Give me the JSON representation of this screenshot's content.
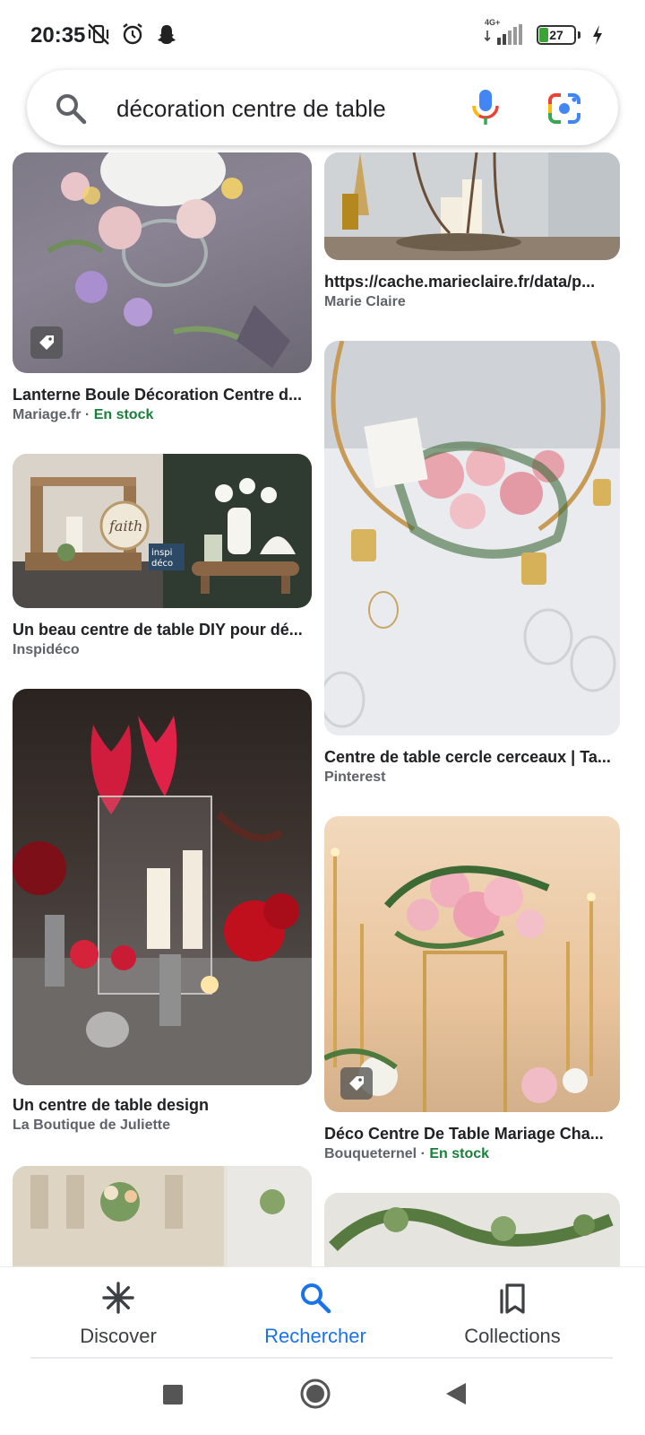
{
  "status_bar": {
    "time": "20:35",
    "network": "4G+",
    "battery": "27",
    "battery_level": 0.27,
    "icons": [
      "vibrate-off-icon",
      "alarm-icon",
      "snapchat-icon",
      "signal-icon",
      "charging-icon"
    ]
  },
  "search": {
    "query": "décoration centre de table",
    "icons": [
      "search-icon",
      "mic-icon",
      "lens-icon"
    ]
  },
  "results": [
    {
      "title": "Lanterne Boule Décoration Centre d...",
      "source": "Mariage.fr",
      "stock": "En stock",
      "tagged": true
    },
    {
      "title": "https://cache.marieclaire.fr/data/p...",
      "source": "Marie Claire",
      "stock": "",
      "tagged": false
    },
    {
      "title": "Un beau centre de table DIY pour dé...",
      "source": "Inspidéco",
      "stock": "",
      "tagged": false
    },
    {
      "title": "Centre de table cercle cerceaux | Ta...",
      "source": "Pinterest",
      "stock": "",
      "tagged": false
    },
    {
      "title": "Un centre de table design",
      "source": "La Boutique de Juliette",
      "stock": "",
      "tagged": false
    },
    {
      "title": "Déco Centre De Table Mariage Cha...",
      "source": "Bouqueternel",
      "stock": "En stock",
      "tagged": true
    }
  ],
  "image_text": {
    "faith_sign": "faith",
    "inspi_logo_1": "inspi",
    "inspi_logo_2": "déco"
  },
  "bottom_nav": {
    "items": [
      {
        "label": "Discover",
        "icon": "discover-icon",
        "active": false
      },
      {
        "label": "Rechercher",
        "icon": "search-icon",
        "active": true
      },
      {
        "label": "Collections",
        "icon": "collections-icon",
        "active": false
      }
    ]
  },
  "colors": {
    "accent": "#1a73e8",
    "stock_green": "#188038",
    "battery_green": "#3aa335"
  }
}
